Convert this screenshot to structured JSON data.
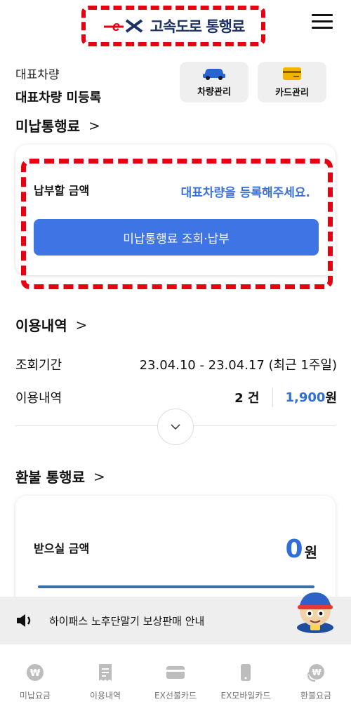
{
  "header": {
    "logo_mark": "ex",
    "title": "고속도로 통행료"
  },
  "vehicle": {
    "label": "대표차량",
    "value": "대표차량 미등록"
  },
  "quick_buttons": {
    "car_label": "차량관리",
    "card_label": "카드관리"
  },
  "unpaid": {
    "title": "미납통행료",
    "pay_label": "납부할 금액",
    "register_message": "대표차량을 등록해주세요.",
    "pay_button": "미납통행료 조회·납부"
  },
  "usage": {
    "title": "이용내역",
    "period_label": "조회기간",
    "period_value": "23.04.10 - 23.04.17 (최근 1주일)",
    "history_label": "이용내역",
    "count": "2 건",
    "amount": "1,900",
    "amount_unit": "원"
  },
  "refund": {
    "title": "환불 통행료",
    "receive_label": "받으실 금액",
    "amount": "0",
    "amount_unit": "원"
  },
  "notice": {
    "text": "하이패스 노후단말기 보상판매 안내"
  },
  "bottom_nav": [
    {
      "label": "미납요금",
      "icon": "won-coin-icon"
    },
    {
      "label": "이용내역",
      "icon": "receipt-icon"
    },
    {
      "label": "EX선불카드",
      "icon": "card-icon"
    },
    {
      "label": "EX모바일카드",
      "icon": "mobile-icon"
    },
    {
      "label": "환불요금",
      "icon": "refund-icon"
    }
  ],
  "colors": {
    "accent_blue": "#3f74e4",
    "brand_red": "#e60012",
    "brand_navy": "#1e3163"
  }
}
